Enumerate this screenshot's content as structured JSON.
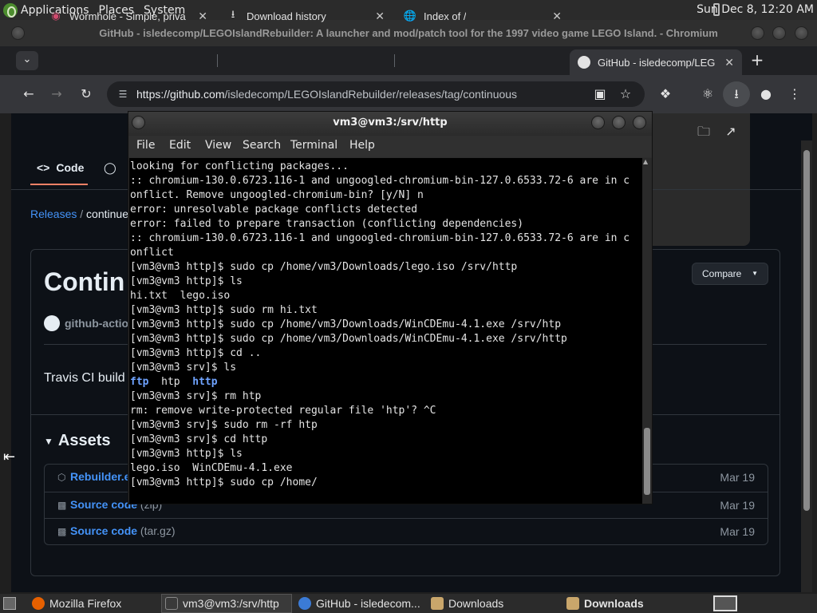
{
  "top_panel": {
    "menus": [
      "Applications",
      "Places",
      "System"
    ],
    "clock": "Sun Dec  8, 12:20 AM"
  },
  "browser": {
    "window_title": "GitHub - isledecomp/LEGOIslandRebuilder: A launcher and mod/patch tool for the 1997 video game LEGO Island. - Chromium",
    "tabs": [
      {
        "label": "Wormhole - Simple, priva",
        "icon": "wormhole-icon"
      },
      {
        "label": "Download history",
        "icon": "download-icon"
      },
      {
        "label": "Index of /",
        "icon": "globe-icon"
      },
      {
        "label": "GitHub - isledecomp/LEG",
        "icon": "github-icon"
      }
    ],
    "url_host": "https://github.com",
    "url_path": "/isledecomp/LEGOIslandRebuilder/releases/tag/continuous"
  },
  "github": {
    "nav_code": "Code",
    "breadcrumb_releases": "Releases",
    "breadcrumb_sep": "/",
    "breadcrumb_current": "continue",
    "release_title": "Contin",
    "author": "github-actio",
    "compare_label": "Compare",
    "body_text": "Travis CI build",
    "assets_title": "Assets",
    "assets": [
      {
        "name": "Rebuilder.e",
        "suffix": "",
        "date": "Mar 19"
      },
      {
        "name": "Source code",
        "suffix": "(zip)",
        "date": "Mar 19"
      },
      {
        "name": "Source code",
        "suffix": "(tar.gz)",
        "date": "Mar 19"
      }
    ]
  },
  "terminal": {
    "title": "vm3@vm3:/srv/http",
    "menu": [
      "File",
      "Edit",
      "View",
      "Search",
      "Terminal",
      "Help"
    ],
    "lines": [
      "looking for conflicting packages...",
      ":: chromium-130.0.6723.116-1 and ungoogled-chromium-bin-127.0.6533.72-6 are in c",
      "onflict. Remove ungoogled-chromium-bin? [y/N] n",
      "error: unresolvable package conflicts detected",
      "error: failed to prepare transaction (conflicting dependencies)",
      ":: chromium-130.0.6723.116-1 and ungoogled-chromium-bin-127.0.6533.72-6 are in c",
      "onflict",
      "[vm3@vm3 http]$ sudo cp /home/vm3/Downloads/lego.iso /srv/http",
      "[vm3@vm3 http]$ ls",
      "hi.txt  lego.iso",
      "[vm3@vm3 http]$ sudo rm hi.txt",
      "[vm3@vm3 http]$ sudo cp /home/vm3/Downloads/WinCDEmu-4.1.exe /srv/htp",
      "[vm3@vm3 http]$ sudo cp /home/vm3/Downloads/WinCDEmu-4.1.exe /srv/http",
      "[vm3@vm3 http]$ cd ..",
      "[vm3@vm3 srv]$ ls",
      "ftp  htp  http",
      "[vm3@vm3 srv]$ rm htp",
      "rm: remove write-protected regular file 'htp'? ^C",
      "[vm3@vm3 srv]$ sudo rm -rf htp",
      "[vm3@vm3 srv]$ cd http",
      "[vm3@vm3 http]$ ls",
      "lego.iso  WinCDEmu-4.1.exe",
      "[vm3@vm3 http]$ sudo cp /home/"
    ]
  },
  "taskbar": {
    "items": [
      {
        "label": "Mozilla Firefox",
        "color": "#e66000"
      },
      {
        "label": "vm3@vm3:/srv/http",
        "color": "#444444"
      },
      {
        "label": "GitHub - isledecom...",
        "color": "#3b7bd6"
      },
      {
        "label": "Downloads",
        "color": "#c9a66b"
      },
      {
        "label": "Downloads",
        "color": "#c9a66b"
      }
    ]
  }
}
